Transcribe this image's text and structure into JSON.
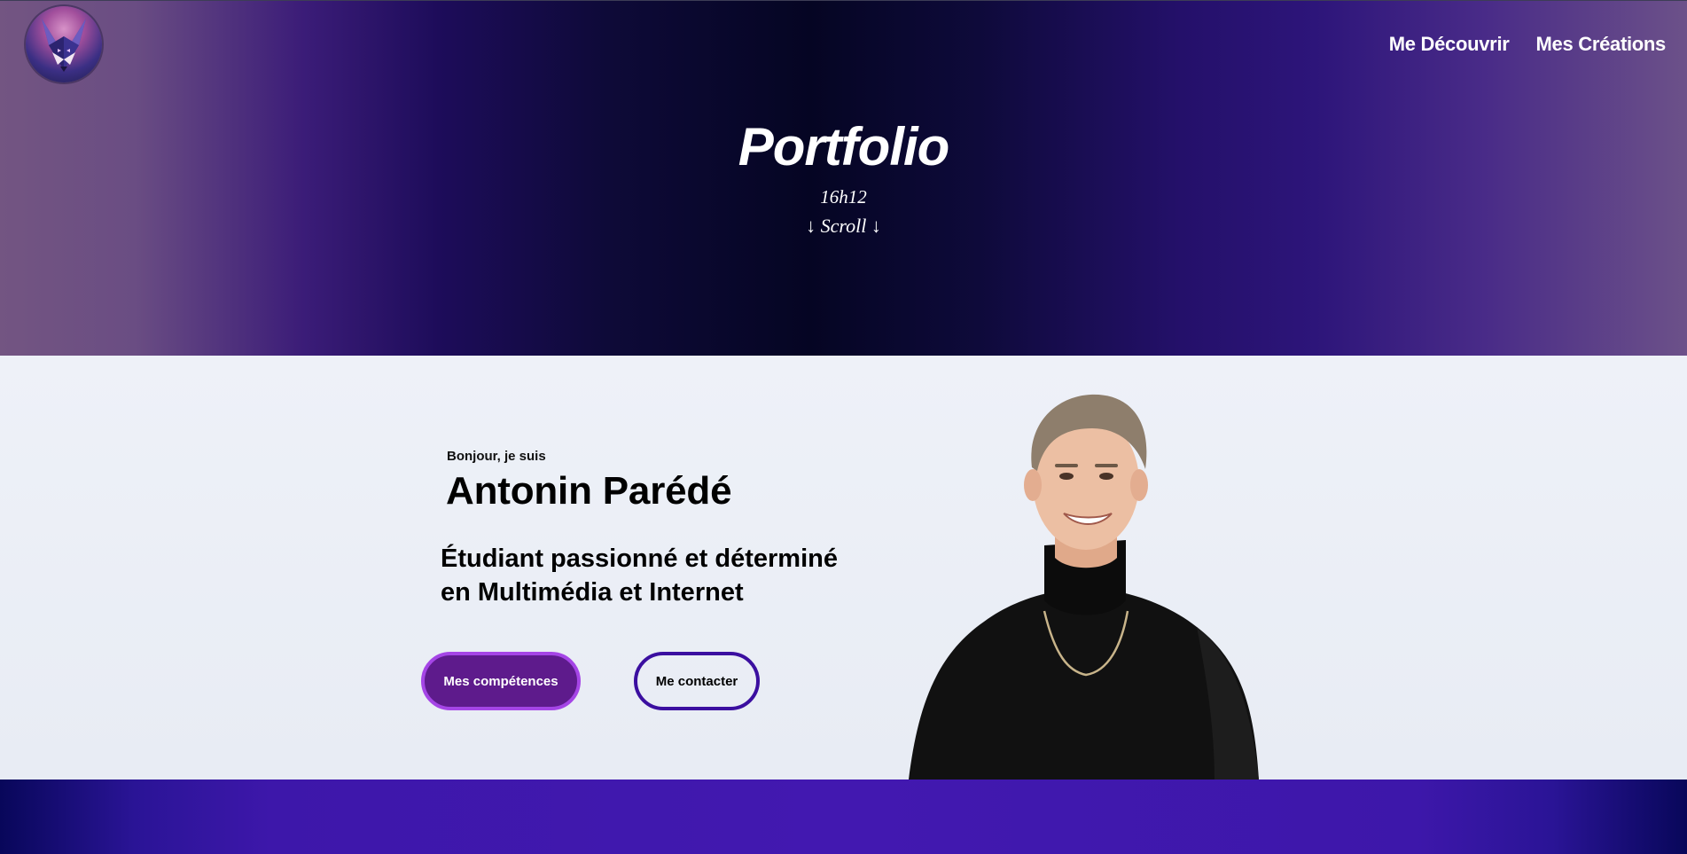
{
  "header": {
    "logo_icon": "fox-logo-icon",
    "nav": [
      {
        "label": "Me Découvrir"
      },
      {
        "label": "Mes Créations"
      }
    ]
  },
  "hero": {
    "title": "Portfolio",
    "time": "16h12",
    "scroll": "↓ Scroll ↓"
  },
  "intro": {
    "greeting": "Bonjour, je suis",
    "name": "Antonin Parédé",
    "tagline_line1": "Étudiant passionné et déterminé",
    "tagline_line2": "en Multimédia et Internet",
    "primary_button": "Mes compétences",
    "secondary_button": "Me contacter"
  },
  "colors": {
    "primary_button_bg": "#5e1b8c",
    "primary_button_border": "#a545e6",
    "secondary_button_border": "#3b0fa0",
    "band": "#4218b0"
  }
}
